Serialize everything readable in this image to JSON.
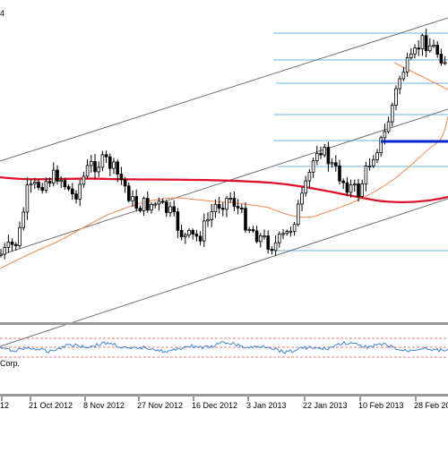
{
  "chart_data": {
    "type": "candlestick",
    "symbol_label_fragment": "4",
    "copyright_fragment": "Corp.",
    "x_tick_labels": [
      "12",
      "21 Oct 2012",
      "8 Nov 2012",
      "27 Nov 2012",
      "16 Dec 2012",
      "3 Jan 2013",
      "22 Jan 2013",
      "10 Feb 2013",
      "28 Feb 20"
    ],
    "colors": {
      "background": "#ffffff",
      "candle": "#000000",
      "ma_long": "#e0102a",
      "ma_short": "#f08850",
      "channel": "#707070",
      "fib_levels": "#8ec4e6",
      "support_line": "#0a24d0",
      "oscillator": "#3a86d4",
      "oscillator_levels": "#e05050",
      "separator": "#9a9a9a"
    },
    "fib_levels_count": 7,
    "oscillator_level_count": 3
  }
}
